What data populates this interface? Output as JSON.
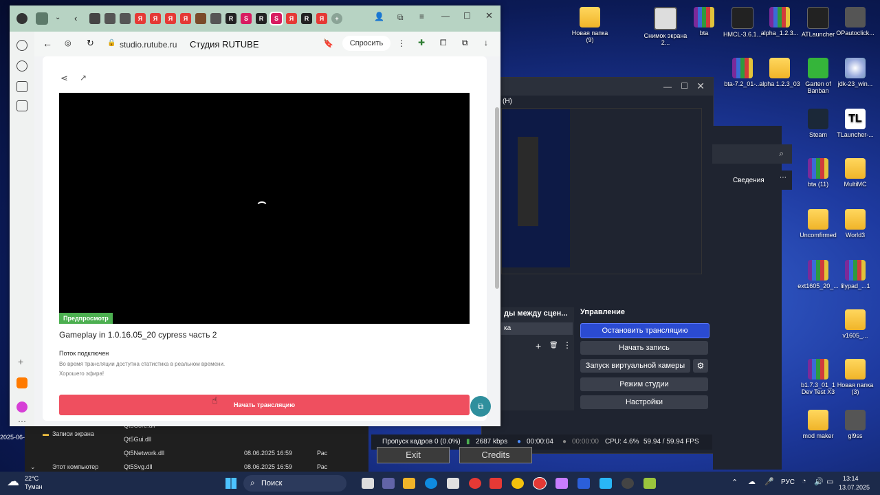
{
  "browser": {
    "address": "studio.rutube.ru",
    "page_title": "Студия RUTUBE",
    "ask_label": "Спросить"
  },
  "stream": {
    "preview_badge": "Предпросмотр",
    "title": "Gameplay in 1.0.16.05_20 cypress часть 2",
    "status": "Поток подключен",
    "info_line1": "Во время трансляции доступна статистика в реальном времени.",
    "info_line2": "Хорошего эфира!",
    "start_button": "Начать трансляцию"
  },
  "obs": {
    "preview_label": "(H)",
    "scene_transitions": "ды между сцен...",
    "scene_select": "ка",
    "controls_title": "Управление",
    "buttons": [
      "Остановить трансляцию",
      "Начать запись",
      "Запуск виртуальной камеры",
      "Режим студии",
      "Настройки"
    ],
    "status": {
      "dropped": "Пропуск кадров 0 (0.0%)",
      "bitrate": "2687 kbps",
      "stream_time": "00:00:04",
      "rec_time": "00:00:00",
      "cpu": "CPU: 4.6%",
      "fps": "59.94 / 59.94 FPS"
    },
    "details_label": "Сведения"
  },
  "game_menu": {
    "exit": "Exit",
    "credits": "Credits"
  },
  "explorer": {
    "folder": "Записи экрана",
    "this_pc": "Этот компьютер",
    "files": [
      {
        "name": "Qt5Core.dll",
        "date": "",
        "type": ""
      },
      {
        "name": "Qt5Gui.dll",
        "date": "",
        "type": ""
      },
      {
        "name": "Qt5Network.dll",
        "date": "08.06.2025 16:59",
        "type": "Рас"
      },
      {
        "name": "Qt5Svg.dll",
        "date": "08.06.2025 16:59",
        "type": "Рас"
      }
    ],
    "left_date": "2025-06-"
  },
  "desktop": {
    "icons": [
      {
        "label": "Новая папка (9)",
        "kind": "folder"
      },
      {
        "label": "Снимок экрана 2...",
        "kind": "shot"
      },
      {
        "label": "bta",
        "kind": "rar"
      },
      {
        "label": "HMCL-3.6.1...",
        "kind": "app"
      },
      {
        "label": "alpha_1.2.3...",
        "kind": "rar"
      },
      {
        "label": "ATLauncher",
        "kind": "app"
      },
      {
        "label": "OPautoclick...",
        "kind": "dark"
      },
      {
        "label": "bta-7.2_01-...",
        "kind": "rar"
      },
      {
        "label": "alpha 1.2.3_03",
        "kind": "folder"
      },
      {
        "label": "Garten of Banban",
        "kind": "green"
      },
      {
        "label": "jdk-23_win...",
        "kind": "cd"
      },
      {
        "label": "Steam",
        "kind": "steam"
      },
      {
        "label": "TLauncher-...",
        "kind": "tl"
      },
      {
        "label": "bta (11)",
        "kind": "rar"
      },
      {
        "label": "MultiMC",
        "kind": "folder"
      },
      {
        "label": "Uncomfirmed",
        "kind": "folder"
      },
      {
        "label": "World3",
        "kind": "folder"
      },
      {
        "label": "ext1605_20_...",
        "kind": "rar"
      },
      {
        "label": "lilypad_...1",
        "kind": "rar"
      },
      {
        "label": "v1605_...",
        "kind": "folder"
      },
      {
        "label": "b1.7.3_01_1 Dev Test X3",
        "kind": "rar"
      },
      {
        "label": "Новая папка (3)",
        "kind": "folder"
      },
      {
        "label": "mod maker",
        "kind": "folder"
      },
      {
        "label": "gl9ss",
        "kind": "dark"
      }
    ]
  },
  "taskbar": {
    "weather_temp": "22°C",
    "weather_desc": "Туман",
    "search_label": "Поиск",
    "lang": "РУС",
    "time": "13:14",
    "date": "13.07.2025"
  }
}
